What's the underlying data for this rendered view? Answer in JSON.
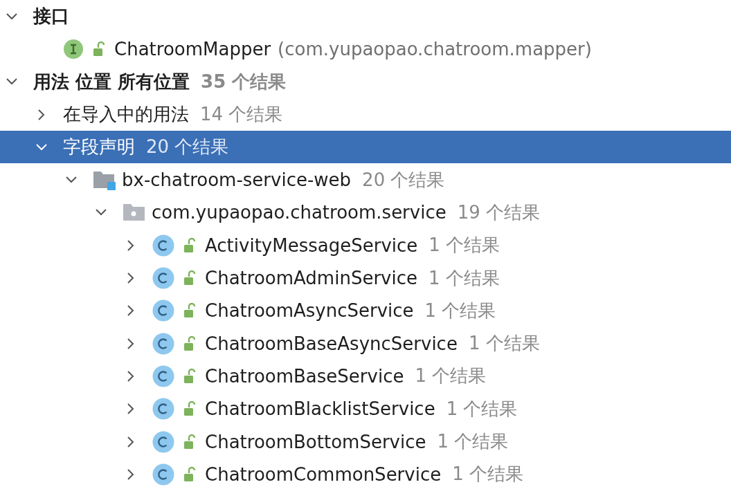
{
  "tree": [
    {
      "kind": "group",
      "label": "接口",
      "expanded": true,
      "selected": false,
      "children": [
        {
          "kind": "interface",
          "label": "ChatroomMapper",
          "detail": "(com.yupaopao.chatroom.mapper)",
          "selected": false
        }
      ]
    },
    {
      "kind": "group",
      "label": "用法 位置 所有位置",
      "count": "35 个结果",
      "expanded": true,
      "selected": false,
      "children": [
        {
          "kind": "category",
          "label": "在导入中的用法",
          "count": "14 个结果",
          "expanded": false,
          "selected": false
        },
        {
          "kind": "category",
          "label": "字段声明",
          "count": "20 个结果",
          "expanded": true,
          "selected": true,
          "children": [
            {
              "kind": "module",
              "label": "bx-chatroom-service-web",
              "count": "20 个结果",
              "expanded": true,
              "selected": false,
              "children": [
                {
                  "kind": "package",
                  "label": "com.yupaopao.chatroom.service",
                  "count": "19 个结果",
                  "expanded": true,
                  "selected": false,
                  "children": [
                    {
                      "kind": "class",
                      "label": "ActivityMessageService",
                      "count": "1 个结果",
                      "expanded": false,
                      "selected": false
                    },
                    {
                      "kind": "class",
                      "label": "ChatroomAdminService",
                      "count": "1 个结果",
                      "expanded": false,
                      "selected": false
                    },
                    {
                      "kind": "class",
                      "label": "ChatroomAsyncService",
                      "count": "1 个结果",
                      "expanded": false,
                      "selected": false
                    },
                    {
                      "kind": "class",
                      "label": "ChatroomBaseAsyncService",
                      "count": "1 个结果",
                      "expanded": false,
                      "selected": false
                    },
                    {
                      "kind": "class",
                      "label": "ChatroomBaseService",
                      "count": "1 个结果",
                      "expanded": false,
                      "selected": false
                    },
                    {
                      "kind": "class",
                      "label": "ChatroomBlacklistService",
                      "count": "1 个结果",
                      "expanded": false,
                      "selected": false
                    },
                    {
                      "kind": "class",
                      "label": "ChatroomBottomService",
                      "count": "1 个结果",
                      "expanded": false,
                      "selected": false
                    },
                    {
                      "kind": "class",
                      "label": "ChatroomCommonService",
                      "count": "1 个结果",
                      "expanded": false,
                      "selected": false
                    }
                  ]
                }
              ]
            }
          ]
        }
      ]
    }
  ]
}
